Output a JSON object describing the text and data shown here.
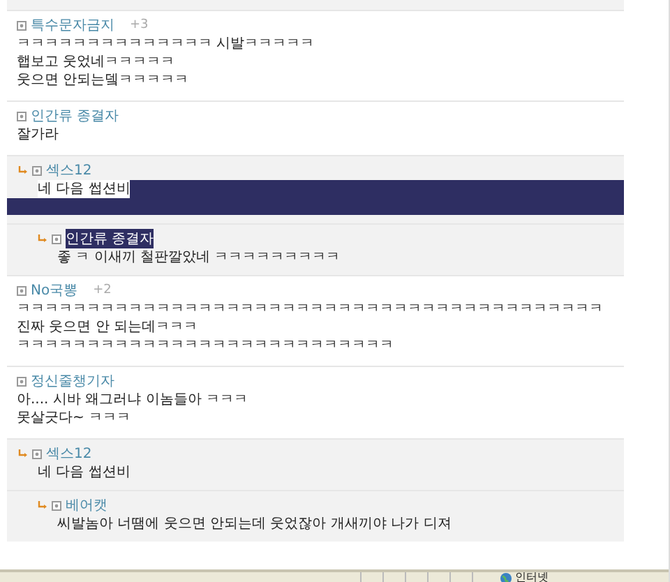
{
  "comments": [
    {
      "author": "특수문자금지",
      "score": "+3",
      "lines": [
        "ㅋㅋㅋㅋㅋㅋㅋㅋㅋㅋㅋㅋㅋㅋ 시발ㅋㅋㅋㅋㅋ",
        "햅보고 웃었네ㅋㅋㅋㅋㅋ",
        "웃으면 안되는뎈ㅋㅋㅋㅋㅋ"
      ]
    },
    {
      "author": "인간류 종결자",
      "lines": [
        "잘가라"
      ],
      "children": [
        {
          "author": "섹스12",
          "author_highlighted": false,
          "lines": [
            "네 다음 썹션비"
          ],
          "selected": true,
          "children": [
            {
              "author": "인간류 종결자",
              "author_highlighted": true,
              "lines": [
                "좋 ㅋ 이새끼 철판깔았네 ㅋㅋㅋㅋㅋㅋㅋㅋㅋ"
              ],
              "selected": false
            }
          ]
        }
      ]
    },
    {
      "author": "No국뽕",
      "score": "+2",
      "lines": [
        "ㅋㅋㅋㅋㅋㅋㅋㅋㅋㅋㅋㅋㅋㅋㅋㅋㅋㅋㅋㅋㅋㅋㅋㅋㅋㅋㅋㅋㅋㅋㅋㅋㅋㅋㅋㅋㅋㅋㅋㅋㅋㅋ 진짜 웃으면 안 되는데ㅋㅋㅋ",
        "ㅋㅋㅋㅋㅋㅋㅋㅋㅋㅋㅋㅋㅋㅋㅋㅋㅋㅋㅋㅋㅋㅋㅋㅋㅋㅋㅋ"
      ]
    },
    {
      "author": "정신줄챙기자",
      "lines": [
        "아.... 시바 왜그러냐 이놈들아 ㅋㅋㅋ",
        "못살긋다~ ㅋㅋㅋ"
      ],
      "children": [
        {
          "author": "섹스12",
          "author_highlighted": false,
          "lines": [
            "네 다음 썹션비"
          ],
          "selected": false,
          "children": [
            {
              "author": "베어캣",
              "author_highlighted": false,
              "lines": [
                "씨발놈아 너땜에 웃으면 안되는데 웃었잖아 개새끼야 나가 디져"
              ],
              "selected": false
            }
          ]
        }
      ]
    }
  ],
  "status_bar": {
    "zone": "인터넷"
  }
}
